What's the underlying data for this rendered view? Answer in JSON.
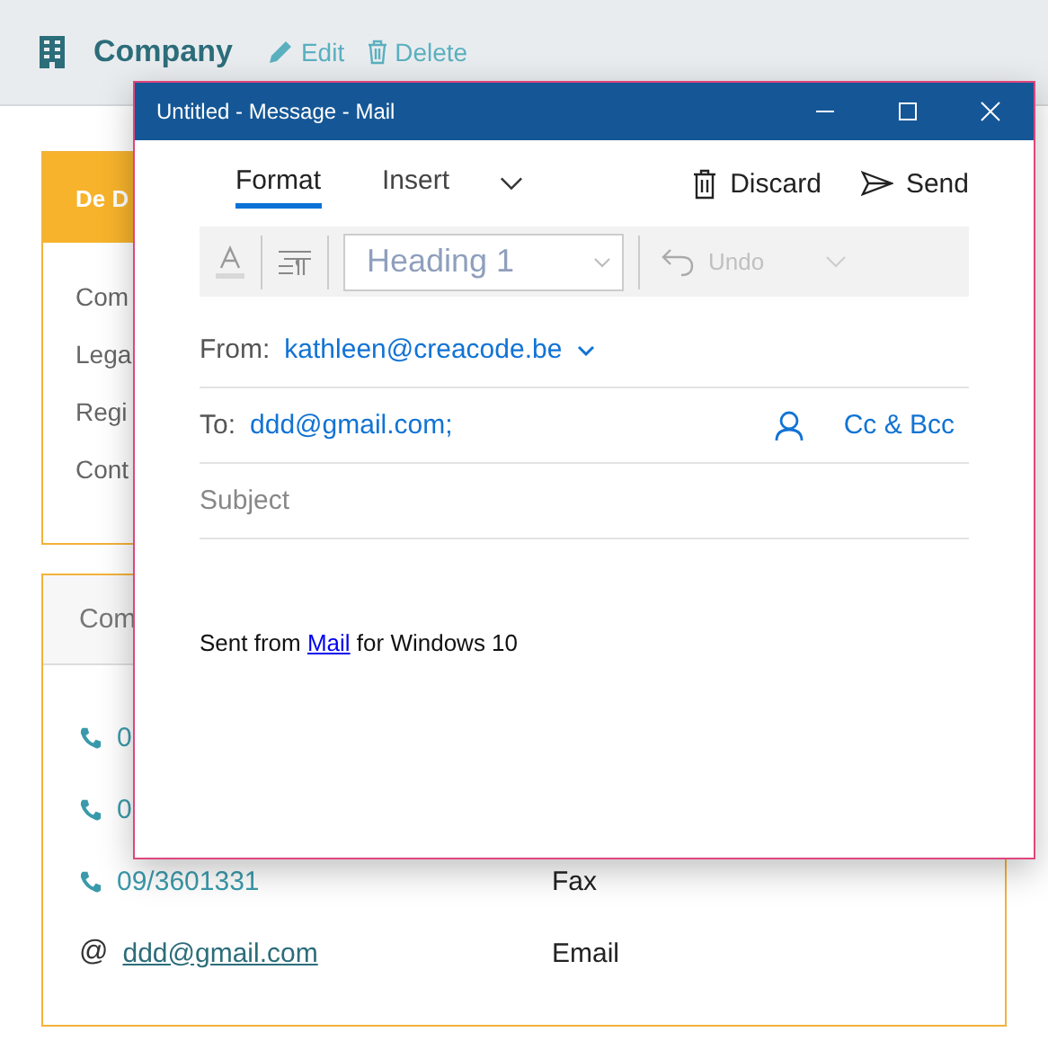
{
  "page": {
    "title": "Company",
    "actions": [
      {
        "kind": "edit",
        "label": "Edit"
      },
      {
        "kind": "delete",
        "label": "Delete"
      }
    ]
  },
  "details_card": {
    "title": "De D",
    "fields": [
      "Com",
      "Lega",
      "Regi",
      "Cont"
    ]
  },
  "contacts_card": {
    "title": "Com",
    "rows": [
      {
        "kind": "phone",
        "value": "0",
        "label": ""
      },
      {
        "kind": "phone",
        "value": "0",
        "label": ""
      },
      {
        "kind": "phone",
        "value": "09/3601331",
        "label": "Fax"
      },
      {
        "kind": "email",
        "symbol": "@",
        "value": "ddd@gmail.com",
        "label": "Email"
      }
    ]
  },
  "mail_window": {
    "title": "Untitled - Message - Mail",
    "tabs": [
      {
        "label": "Format",
        "selected": true
      },
      {
        "label": "Insert",
        "selected": false
      }
    ],
    "actions": [
      {
        "kind": "discard",
        "label": "Discard"
      },
      {
        "kind": "send",
        "label": "Send"
      }
    ],
    "format_bar": {
      "style": "Heading 1",
      "undo": "Undo",
      "disabled": true
    },
    "from_label": "From:",
    "from": "kathleen@creacode.be",
    "to_label": "To:",
    "to": "ddd@gmail.com;",
    "cc_bcc": "Cc & Bcc",
    "subject": {
      "placeholder": "Subject"
    },
    "signature": {
      "before": "Sent from ",
      "link": "Mail",
      "after": " for Windows 10"
    }
  }
}
